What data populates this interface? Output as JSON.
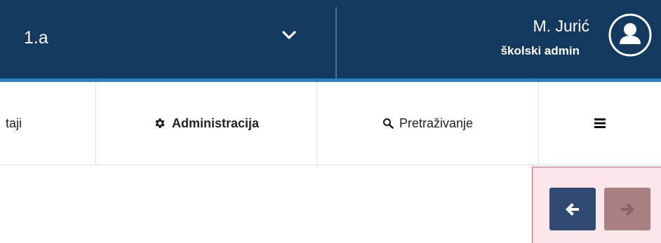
{
  "header": {
    "class_selector": {
      "value": "1.a",
      "icon": "chevron-down-icon"
    },
    "user": {
      "name": "M. Jurić",
      "role": "školski admin",
      "icon": "user-avatar-icon"
    },
    "colors": {
      "background": "#133a5e",
      "accent": "#2a7ec6"
    }
  },
  "nav": {
    "items": [
      {
        "label": "taji",
        "icon": ""
      },
      {
        "label": "Administracija",
        "icon": "gear-icon"
      },
      {
        "label": "Pretraživanje",
        "icon": "search-icon"
      },
      {
        "label": "",
        "icon": "hamburger-menu-icon"
      }
    ]
  },
  "pager": {
    "prev": {
      "icon": "arrow-left-icon",
      "enabled": true,
      "color": "#2e4a72"
    },
    "next": {
      "icon": "arrow-right-icon",
      "enabled": false,
      "color": "#a88081"
    },
    "highlight_color": "#fde6e9"
  }
}
